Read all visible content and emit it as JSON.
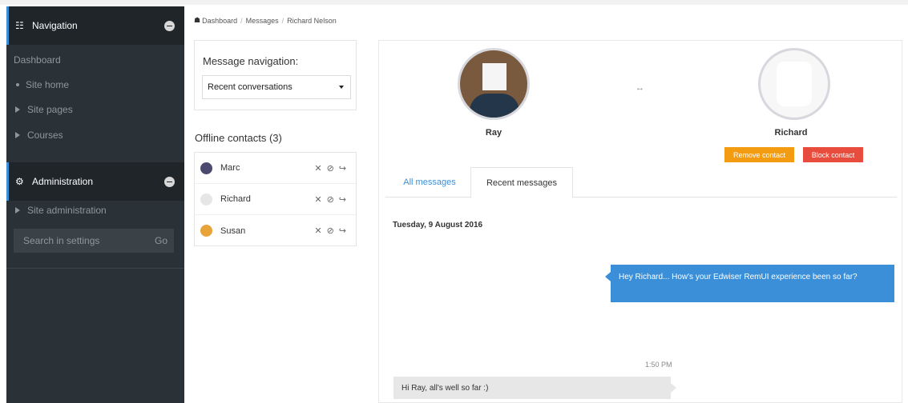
{
  "breadcrumb": {
    "items": [
      "Dashboard",
      "Messages",
      "Richard Nelson"
    ]
  },
  "sidebar": {
    "navigation": {
      "title": "Navigation",
      "dashboard": "Dashboard",
      "items": [
        "Site home",
        "Site pages",
        "Courses"
      ]
    },
    "administration": {
      "title": "Administration",
      "items": [
        "Site administration"
      ],
      "search_placeholder": "Search in settings",
      "search_go": "Go"
    }
  },
  "message_navigation": {
    "title": "Message navigation:",
    "selected": "Recent conversations"
  },
  "offline_contacts": {
    "title": "Offline contacts (3)",
    "contacts": [
      {
        "name": "Marc",
        "avatar_color": "#4b4a6e"
      },
      {
        "name": "Richard",
        "avatar_color": "#d9d9d9"
      },
      {
        "name": "Susan",
        "avatar_color": "#e8a33b"
      }
    ]
  },
  "conversation": {
    "user_name": "Ray",
    "contact_name": "Richard",
    "remove_label": "Remove contact",
    "block_label": "Block contact",
    "tabs": [
      "All messages",
      "Recent messages"
    ],
    "active_tab": "Recent messages",
    "date": "Tuesday, 9 August 2016",
    "messages": [
      {
        "direction": "out",
        "text": "Hey Richard... How's your Edwiser RemUI experience been so far?"
      },
      {
        "direction": "in",
        "time": "1:50 PM",
        "text": "Hi Ray, all's well so far :)"
      }
    ]
  },
  "colors": {
    "sidebar_bg": "#2b3237",
    "accent": "#3a8fd8",
    "remove": "#f39c12",
    "block": "#e74c3c"
  }
}
